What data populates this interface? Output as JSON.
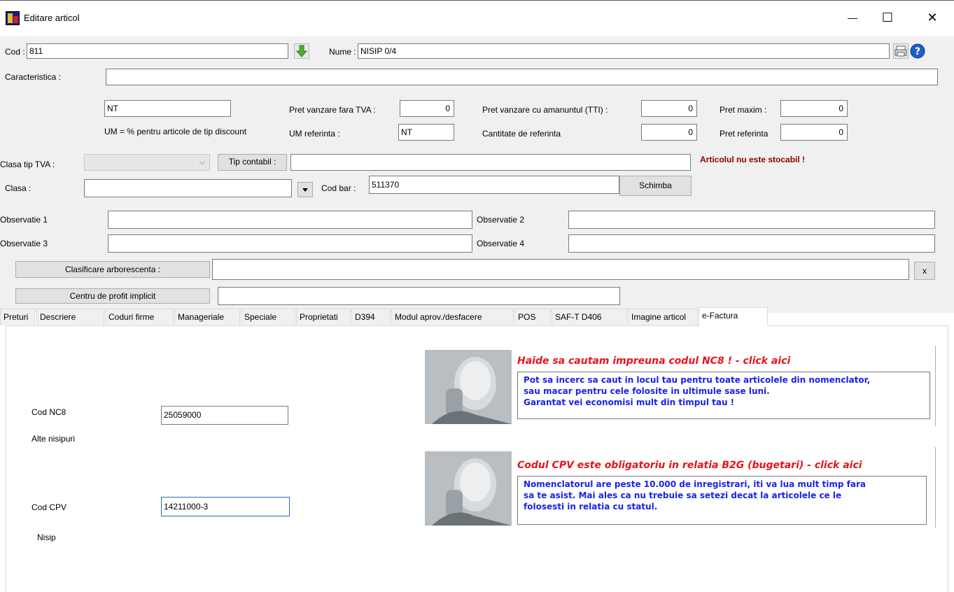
{
  "window": {
    "title": "Editare articol",
    "minimize": "—",
    "maximize": "☐",
    "close": "✕"
  },
  "form": {
    "cod_label": "Cod :",
    "cod_value": "811",
    "nume_label": "Nume :",
    "nume_value": "NISIP 0/4",
    "caracteristica_label": "Caracteristica :",
    "caracteristica_value": "",
    "um_value": "NT",
    "um_note": "UM = % pentru articole de tip discount",
    "pret_fara_tva_label": "Pret vanzare fara TVA :",
    "pret_fara_tva_value": "0",
    "um_referinta_label": "UM referinta :",
    "um_referinta_value": "NT",
    "pret_amanuntul_label": "Pret vanzare cu amanuntul (TTI) :",
    "pret_amanuntul_value": "0",
    "cantitate_ref_label": "Cantitate de referinta",
    "cantitate_ref_value": "0",
    "pret_maxim_label": "Pret maxim :",
    "pret_maxim_value": "0",
    "pret_referinta_label": "Pret referinta",
    "pret_referinta_value": "0",
    "clasa_tva_label": "Clasa tip TVA :",
    "clasa_tva_value": "",
    "tip_contabil_button": "Tip contabil :",
    "tip_contabil_value": "",
    "stocabil_warning": "Articolul nu este stocabil !",
    "clasa_label": "Clasa :",
    "clasa_value": "",
    "cod_bar_label": "Cod bar :",
    "cod_bar_value": "511370",
    "schimba_button": "Schimba",
    "obs1_label": "Observatie 1",
    "obs2_label": "Observatie 2",
    "obs3_label": "Observatie 3",
    "obs4_label": "Observatie 4",
    "obs1_value": "",
    "obs2_value": "",
    "obs3_value": "",
    "obs4_value": "",
    "clasificare_button": "Clasificare arborescenta :",
    "clasificare_value": "",
    "clear_button": "x",
    "centru_profit_button": "Centru de profit implicit",
    "centru_profit_value": ""
  },
  "tabs": [
    {
      "label": "Preturi"
    },
    {
      "label": "Descriere"
    },
    {
      "label": "Coduri firme"
    },
    {
      "label": "Manageriale"
    },
    {
      "label": "Speciale"
    },
    {
      "label": "Proprietati"
    },
    {
      "label": "D394"
    },
    {
      "label": "Modul aprov./desfacere"
    },
    {
      "label": "POS"
    },
    {
      "label": "SAF-T D406"
    },
    {
      "label": "Imagine articol"
    },
    {
      "label": "e-Factura",
      "active": true
    }
  ],
  "efactura": {
    "nc8_label": "Cod NC8",
    "nc8_value": "25059000",
    "nc8_description": "Alte nisipuri",
    "cpv_label": "Cod CPV",
    "cpv_value": "14211000-3",
    "cpv_description": "Nisip",
    "promo1_title": "Haide sa cautam impreuna codul NC8 ! - click aici",
    "promo1_line1": "Pot sa incerc sa caut in locul tau pentru toate articolele din nomenclator,",
    "promo1_line2": "sau macar pentru cele folosite in ultimule sase luni.",
    "promo1_line3": "Garantat vei economisi mult din timpul tau !",
    "promo2_title": "Codul CPV este obligatoriu in relatia B2G (bugetari) - click aici",
    "promo2_line1": "Nomenclatorul are peste 10.000 de inregistrari, iti va lua mult timp fara",
    "promo2_line2": "sa te asist. Mai ales ca nu trebuie sa setezi decat la articolele ce le",
    "promo2_line3": "folosesti in relatia cu statul."
  },
  "colors": {
    "warning": "#8b0000",
    "promo_title": "#e8141a",
    "promo_text": "#1a23e8",
    "form_bg": "#f0f0f0"
  }
}
